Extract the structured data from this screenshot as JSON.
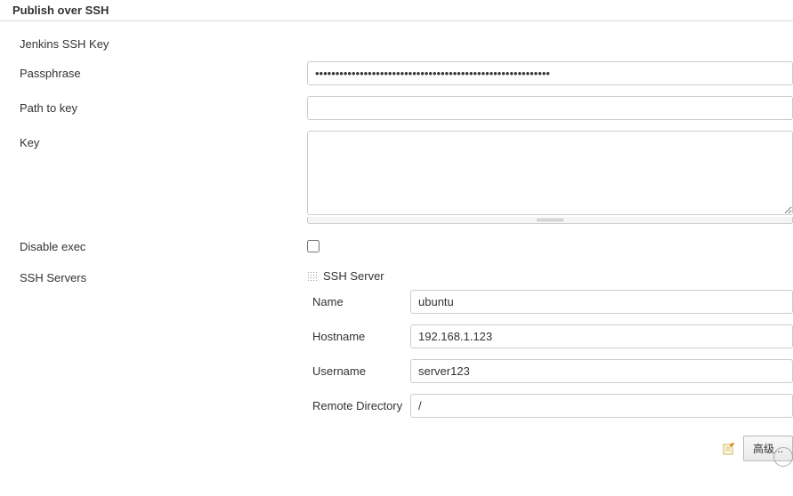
{
  "section": {
    "title": "Publish over SSH"
  },
  "labels": {
    "jenkinsSshKey": "Jenkins SSH Key",
    "passphrase": "Passphrase",
    "pathToKey": "Path to key",
    "key": "Key",
    "disableExec": "Disable exec",
    "sshServers": "SSH Servers"
  },
  "values": {
    "passphrase": "••••••••••••••••••••••••••••••••••••••••••••••••••••••••••",
    "pathToKey": "",
    "key": "",
    "disableExec": false
  },
  "sshServer": {
    "header": "SSH Server",
    "labels": {
      "name": "Name",
      "hostname": "Hostname",
      "username": "Username",
      "remoteDirectory": "Remote Directory"
    },
    "values": {
      "name": "ubuntu",
      "hostname": "192.168.1.123",
      "username": "server123",
      "remoteDirectory": "/"
    }
  },
  "buttons": {
    "advanced": "高级..."
  }
}
